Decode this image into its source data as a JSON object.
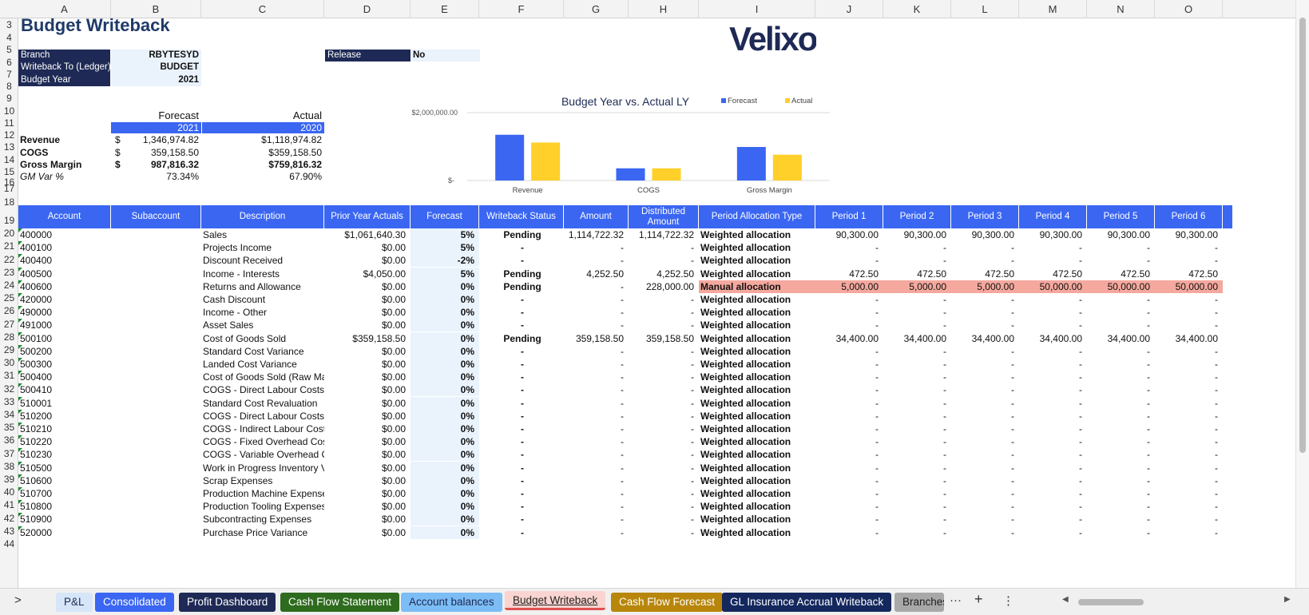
{
  "columns": [
    "A",
    "B",
    "C",
    "D",
    "E",
    "F",
    "G",
    "H",
    "I",
    "J",
    "K",
    "L",
    "M",
    "N",
    "O"
  ],
  "row_numbers": [
    3,
    4,
    5,
    6,
    7,
    8,
    9,
    10,
    11,
    12,
    13,
    14,
    15,
    16,
    17,
    18,
    19,
    20,
    21,
    22,
    23,
    24,
    25,
    26,
    27,
    28,
    29,
    30,
    31,
    32,
    33,
    34,
    35,
    36,
    37,
    38,
    39,
    40,
    41,
    42,
    43,
    44
  ],
  "title": "Budget Writeback",
  "logo": "Velixo",
  "params": {
    "branch_label": "Branch",
    "branch_value": "RBYTESYD",
    "writeback_label": "Writeback To (Ledger)",
    "writeback_value": "BUDGET",
    "budget_year_label": "Budget Year",
    "budget_year_value": "2021",
    "release_label": "Release",
    "release_value": "No"
  },
  "summary": {
    "forecast_label": "Forecast",
    "actual_label": "Actual",
    "forecast_year": "2021",
    "actual_year": "2020",
    "rows": [
      {
        "label": "Revenue",
        "cur": "$",
        "forecast": "1,346,974.82",
        "actual": "$1,118,974.82",
        "bold": false
      },
      {
        "label": "COGS",
        "cur": "$",
        "forecast": "359,158.50",
        "actual": "$359,158.50",
        "bold": false
      },
      {
        "label": "Gross Margin",
        "cur": "$",
        "forecast": "987,816.32",
        "actual": "$759,816.32",
        "bold": true
      }
    ],
    "gm_label": "GM Var %",
    "gm_forecast": "73.34%",
    "gm_actual": "67.90%"
  },
  "chart_data": {
    "type": "bar",
    "title": "Budget Year vs. Actual LY",
    "categories": [
      "Revenue",
      "COGS",
      "Gross Margin"
    ],
    "series": [
      {
        "name": "Forecast",
        "color": "#3a66f2",
        "values": [
          1346974.82,
          359158.5,
          987816.32
        ]
      },
      {
        "name": "Actual",
        "color": "#ffd02a",
        "values": [
          1118974.82,
          359158.5,
          759816.32
        ]
      }
    ],
    "ylim": [
      0,
      2000000
    ],
    "yticks": [
      "$2,000,000.00",
      "$-"
    ],
    "legend": "top-right",
    "grid": true
  },
  "table": {
    "headers": [
      "Account",
      "Subaccount",
      "Description",
      "Prior Year Actuals",
      "Forecast",
      "Writeback Status",
      "Amount",
      "Distributed Amount",
      "Period Allocation Type",
      "Period 1",
      "Period 2",
      "Period 3",
      "Period 4",
      "Period 5",
      "Period 6"
    ],
    "rows": [
      [
        "400000",
        "",
        "Sales",
        "$1,061,640.30",
        "5%",
        "Pending",
        "1,114,722.32",
        "1,114,722.32",
        "Weighted allocation",
        "90,300.00",
        "90,300.00",
        "90,300.00",
        "90,300.00",
        "90,300.00",
        "90,300.00"
      ],
      [
        "400100",
        "",
        "Projects Income",
        "$0.00",
        "5%",
        "-",
        "-",
        "-",
        "Weighted allocation",
        "-",
        "-",
        "-",
        "-",
        "-",
        "-"
      ],
      [
        "400400",
        "",
        "Discount Received",
        "$0.00",
        "-2%",
        "-",
        "-",
        "-",
        "Weighted allocation",
        "-",
        "-",
        "-",
        "-",
        "-",
        "-"
      ],
      [
        "400500",
        "",
        "Income - Interests",
        "$4,050.00",
        "5%",
        "Pending",
        "4,252.50",
        "4,252.50",
        "Weighted allocation",
        "472.50",
        "472.50",
        "472.50",
        "472.50",
        "472.50",
        "472.50"
      ],
      [
        "400600",
        "",
        "Returns and Allowance",
        "$0.00",
        "0%",
        "Pending",
        "-",
        "228,000.00",
        "Manual allocation",
        "5,000.00",
        "5,000.00",
        "5,000.00",
        "50,000.00",
        "50,000.00",
        "50,000.00"
      ],
      [
        "420000",
        "",
        "Cash Discount",
        "$0.00",
        "0%",
        "-",
        "-",
        "-",
        "Weighted allocation",
        "-",
        "-",
        "-",
        "-",
        "-",
        "-"
      ],
      [
        "490000",
        "",
        "Income - Other",
        "$0.00",
        "0%",
        "-",
        "-",
        "-",
        "Weighted allocation",
        "-",
        "-",
        "-",
        "-",
        "-",
        "-"
      ],
      [
        "491000",
        "",
        "Asset Sales",
        "$0.00",
        "0%",
        "-",
        "-",
        "-",
        "Weighted allocation",
        "-",
        "-",
        "-",
        "-",
        "-",
        "-"
      ],
      [
        "500100",
        "",
        "Cost of Goods Sold",
        "$359,158.50",
        "0%",
        "Pending",
        "359,158.50",
        "359,158.50",
        "Weighted allocation",
        "34,400.00",
        "34,400.00",
        "34,400.00",
        "34,400.00",
        "34,400.00",
        "34,400.00"
      ],
      [
        "500200",
        "",
        "Standard Cost Variance",
        "$0.00",
        "0%",
        "-",
        "-",
        "-",
        "Weighted allocation",
        "-",
        "-",
        "-",
        "-",
        "-",
        "-"
      ],
      [
        "500300",
        "",
        "Landed Cost Variance",
        "$0.00",
        "0%",
        "-",
        "-",
        "-",
        "Weighted allocation",
        "-",
        "-",
        "-",
        "-",
        "-",
        "-"
      ],
      [
        "500400",
        "",
        "Cost of Goods Sold (Raw Mate",
        "$0.00",
        "0%",
        "-",
        "-",
        "-",
        "Weighted allocation",
        "-",
        "-",
        "-",
        "-",
        "-",
        "-"
      ],
      [
        "500410",
        "",
        "COGS - Direct Labour Costs",
        "$0.00",
        "0%",
        "-",
        "-",
        "-",
        "Weighted allocation",
        "-",
        "-",
        "-",
        "-",
        "-",
        "-"
      ],
      [
        "510001",
        "",
        "Standard Cost Revaluation",
        "$0.00",
        "0%",
        "-",
        "-",
        "-",
        "Weighted allocation",
        "-",
        "-",
        "-",
        "-",
        "-",
        "-"
      ],
      [
        "510200",
        "",
        "COGS - Direct Labour Costs",
        "$0.00",
        "0%",
        "-",
        "-",
        "-",
        "Weighted allocation",
        "-",
        "-",
        "-",
        "-",
        "-",
        "-"
      ],
      [
        "510210",
        "",
        "COGS - Indirect Labour Costs",
        "$0.00",
        "0%",
        "-",
        "-",
        "-",
        "Weighted allocation",
        "-",
        "-",
        "-",
        "-",
        "-",
        "-"
      ],
      [
        "510220",
        "",
        "COGS - Fixed Overhead Costs",
        "$0.00",
        "0%",
        "-",
        "-",
        "-",
        "Weighted allocation",
        "-",
        "-",
        "-",
        "-",
        "-",
        "-"
      ],
      [
        "510230",
        "",
        "COGS - Variable Overhead Co",
        "$0.00",
        "0%",
        "-",
        "-",
        "-",
        "Weighted allocation",
        "-",
        "-",
        "-",
        "-",
        "-",
        "-"
      ],
      [
        "510500",
        "",
        "Work in Progress Inventory Va",
        "$0.00",
        "0%",
        "-",
        "-",
        "-",
        "Weighted allocation",
        "-",
        "-",
        "-",
        "-",
        "-",
        "-"
      ],
      [
        "510600",
        "",
        "Scrap Expenses",
        "$0.00",
        "0%",
        "-",
        "-",
        "-",
        "Weighted allocation",
        "-",
        "-",
        "-",
        "-",
        "-",
        "-"
      ],
      [
        "510700",
        "",
        "Production Machine Expense",
        "$0.00",
        "0%",
        "-",
        "-",
        "-",
        "Weighted allocation",
        "-",
        "-",
        "-",
        "-",
        "-",
        "-"
      ],
      [
        "510800",
        "",
        "Production Tooling Expenses",
        "$0.00",
        "0%",
        "-",
        "-",
        "-",
        "Weighted allocation",
        "-",
        "-",
        "-",
        "-",
        "-",
        "-"
      ],
      [
        "510900",
        "",
        "Subcontracting Expenses",
        "$0.00",
        "0%",
        "-",
        "-",
        "-",
        "Weighted allocation",
        "-",
        "-",
        "-",
        "-",
        "-",
        "-"
      ],
      [
        "520000",
        "",
        "Purchase Price Variance",
        "$0.00",
        "0%",
        "-",
        "-",
        "-",
        "Weighted allocation",
        "-",
        "-",
        "-",
        "-",
        "-",
        "-"
      ]
    ]
  },
  "tabs": [
    {
      "label": "P&L",
      "bg": "#d6e6f8",
      "fg": "#1e2a55",
      "active": false
    },
    {
      "label": "Consolidated",
      "bg": "#3a66f2",
      "fg": "#ffffff",
      "active": false
    },
    {
      "label": "Profit Dashboard",
      "bg": "#1e2a55",
      "fg": "#ffffff",
      "active": false
    },
    {
      "label": "Cash Flow Statement",
      "bg": "#2e6b1e",
      "fg": "#ffffff",
      "active": false
    },
    {
      "label": "Account balances",
      "bg": "#7cbdf5",
      "fg": "#1e2a55",
      "active": false
    },
    {
      "label": "Budget Writeback",
      "bg": "#f9d4d0",
      "fg": "#222222",
      "active": true
    },
    {
      "label": "Cash Flow Forecast",
      "bg": "#b8860b",
      "fg": "#ffffff",
      "active": false
    },
    {
      "label": "GL Insurance Accrual Writeback",
      "bg": "#14285e",
      "fg": "#ffffff",
      "active": false
    },
    {
      "label": "Branches",
      "bg": "#a8a8a8",
      "fg": "#222222",
      "active": false
    }
  ],
  "tab_controls": {
    "prev": ">",
    "more": "···",
    "add": "+",
    "menu": "⋮"
  }
}
